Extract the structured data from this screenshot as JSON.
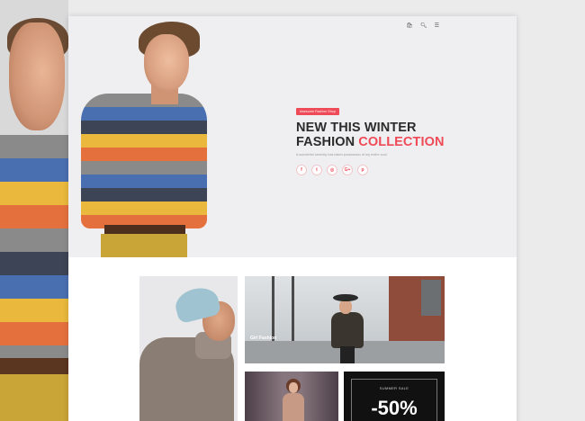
{
  "top_icons": [
    "bag-icon",
    "search-icon",
    "menu-icon"
  ],
  "hero": {
    "badge": "Awesome Fashion Shop",
    "headline_line1": "NEW THIS WINTER",
    "headline_line2_prefix": "FASHION ",
    "headline_line2_accent": "COLLECTION",
    "subline": "A wonderful serenity has taken possession of my entire soul",
    "socials": [
      {
        "icon": "facebook-icon",
        "glyph": "f"
      },
      {
        "icon": "twitter-icon",
        "glyph": "t"
      },
      {
        "icon": "instagram-icon",
        "glyph": "◎"
      },
      {
        "icon": "google-plus-icon",
        "glyph": "G+"
      },
      {
        "icon": "pinterest-icon",
        "glyph": "p"
      }
    ]
  },
  "grid": {
    "street_caption": "Girl Fashion",
    "sale_label": "SUMMER SALE",
    "sale_value": "-50%"
  },
  "colors": {
    "accent": "#ef4a57",
    "text": "#2b2b2b",
    "hero_bg": "#efeff1",
    "sale_bg": "#111111"
  }
}
